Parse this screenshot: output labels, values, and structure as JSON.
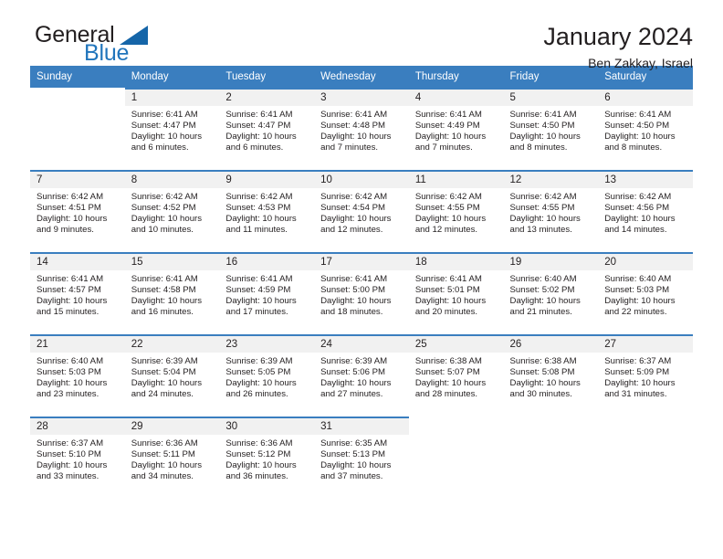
{
  "brand": {
    "name_part1": "General",
    "name_part2": "Blue",
    "accent_color": "#2175bc",
    "triangle_color": "#1565a8",
    "triangle_icon": "triangle-icon"
  },
  "header": {
    "title": "January 2024",
    "subtitle": "Ben Zakkay, Israel"
  },
  "calendar": {
    "header_bg": "#3a7ebf",
    "daynum_bg": "#f1f1f1",
    "weekday_headers": [
      "Sunday",
      "Monday",
      "Tuesday",
      "Wednesday",
      "Thursday",
      "Friday",
      "Saturday"
    ],
    "weeks": [
      [
        {
          "day": "",
          "sunrise": "",
          "sunset": "",
          "daylight_line1": "",
          "daylight_line2": ""
        },
        {
          "day": "1",
          "sunrise": "Sunrise: 6:41 AM",
          "sunset": "Sunset: 4:47 PM",
          "daylight_line1": "Daylight: 10 hours",
          "daylight_line2": "and 6 minutes."
        },
        {
          "day": "2",
          "sunrise": "Sunrise: 6:41 AM",
          "sunset": "Sunset: 4:47 PM",
          "daylight_line1": "Daylight: 10 hours",
          "daylight_line2": "and 6 minutes."
        },
        {
          "day": "3",
          "sunrise": "Sunrise: 6:41 AM",
          "sunset": "Sunset: 4:48 PM",
          "daylight_line1": "Daylight: 10 hours",
          "daylight_line2": "and 7 minutes."
        },
        {
          "day": "4",
          "sunrise": "Sunrise: 6:41 AM",
          "sunset": "Sunset: 4:49 PM",
          "daylight_line1": "Daylight: 10 hours",
          "daylight_line2": "and 7 minutes."
        },
        {
          "day": "5",
          "sunrise": "Sunrise: 6:41 AM",
          "sunset": "Sunset: 4:50 PM",
          "daylight_line1": "Daylight: 10 hours",
          "daylight_line2": "and 8 minutes."
        },
        {
          "day": "6",
          "sunrise": "Sunrise: 6:41 AM",
          "sunset": "Sunset: 4:50 PM",
          "daylight_line1": "Daylight: 10 hours",
          "daylight_line2": "and 8 minutes."
        }
      ],
      [
        {
          "day": "7",
          "sunrise": "Sunrise: 6:42 AM",
          "sunset": "Sunset: 4:51 PM",
          "daylight_line1": "Daylight: 10 hours",
          "daylight_line2": "and 9 minutes."
        },
        {
          "day": "8",
          "sunrise": "Sunrise: 6:42 AM",
          "sunset": "Sunset: 4:52 PM",
          "daylight_line1": "Daylight: 10 hours",
          "daylight_line2": "and 10 minutes."
        },
        {
          "day": "9",
          "sunrise": "Sunrise: 6:42 AM",
          "sunset": "Sunset: 4:53 PM",
          "daylight_line1": "Daylight: 10 hours",
          "daylight_line2": "and 11 minutes."
        },
        {
          "day": "10",
          "sunrise": "Sunrise: 6:42 AM",
          "sunset": "Sunset: 4:54 PM",
          "daylight_line1": "Daylight: 10 hours",
          "daylight_line2": "and 12 minutes."
        },
        {
          "day": "11",
          "sunrise": "Sunrise: 6:42 AM",
          "sunset": "Sunset: 4:55 PM",
          "daylight_line1": "Daylight: 10 hours",
          "daylight_line2": "and 12 minutes."
        },
        {
          "day": "12",
          "sunrise": "Sunrise: 6:42 AM",
          "sunset": "Sunset: 4:55 PM",
          "daylight_line1": "Daylight: 10 hours",
          "daylight_line2": "and 13 minutes."
        },
        {
          "day": "13",
          "sunrise": "Sunrise: 6:42 AM",
          "sunset": "Sunset: 4:56 PM",
          "daylight_line1": "Daylight: 10 hours",
          "daylight_line2": "and 14 minutes."
        }
      ],
      [
        {
          "day": "14",
          "sunrise": "Sunrise: 6:41 AM",
          "sunset": "Sunset: 4:57 PM",
          "daylight_line1": "Daylight: 10 hours",
          "daylight_line2": "and 15 minutes."
        },
        {
          "day": "15",
          "sunrise": "Sunrise: 6:41 AM",
          "sunset": "Sunset: 4:58 PM",
          "daylight_line1": "Daylight: 10 hours",
          "daylight_line2": "and 16 minutes."
        },
        {
          "day": "16",
          "sunrise": "Sunrise: 6:41 AM",
          "sunset": "Sunset: 4:59 PM",
          "daylight_line1": "Daylight: 10 hours",
          "daylight_line2": "and 17 minutes."
        },
        {
          "day": "17",
          "sunrise": "Sunrise: 6:41 AM",
          "sunset": "Sunset: 5:00 PM",
          "daylight_line1": "Daylight: 10 hours",
          "daylight_line2": "and 18 minutes."
        },
        {
          "day": "18",
          "sunrise": "Sunrise: 6:41 AM",
          "sunset": "Sunset: 5:01 PM",
          "daylight_line1": "Daylight: 10 hours",
          "daylight_line2": "and 20 minutes."
        },
        {
          "day": "19",
          "sunrise": "Sunrise: 6:40 AM",
          "sunset": "Sunset: 5:02 PM",
          "daylight_line1": "Daylight: 10 hours",
          "daylight_line2": "and 21 minutes."
        },
        {
          "day": "20",
          "sunrise": "Sunrise: 6:40 AM",
          "sunset": "Sunset: 5:03 PM",
          "daylight_line1": "Daylight: 10 hours",
          "daylight_line2": "and 22 minutes."
        }
      ],
      [
        {
          "day": "21",
          "sunrise": "Sunrise: 6:40 AM",
          "sunset": "Sunset: 5:03 PM",
          "daylight_line1": "Daylight: 10 hours",
          "daylight_line2": "and 23 minutes."
        },
        {
          "day": "22",
          "sunrise": "Sunrise: 6:39 AM",
          "sunset": "Sunset: 5:04 PM",
          "daylight_line1": "Daylight: 10 hours",
          "daylight_line2": "and 24 minutes."
        },
        {
          "day": "23",
          "sunrise": "Sunrise: 6:39 AM",
          "sunset": "Sunset: 5:05 PM",
          "daylight_line1": "Daylight: 10 hours",
          "daylight_line2": "and 26 minutes."
        },
        {
          "day": "24",
          "sunrise": "Sunrise: 6:39 AM",
          "sunset": "Sunset: 5:06 PM",
          "daylight_line1": "Daylight: 10 hours",
          "daylight_line2": "and 27 minutes."
        },
        {
          "day": "25",
          "sunrise": "Sunrise: 6:38 AM",
          "sunset": "Sunset: 5:07 PM",
          "daylight_line1": "Daylight: 10 hours",
          "daylight_line2": "and 28 minutes."
        },
        {
          "day": "26",
          "sunrise": "Sunrise: 6:38 AM",
          "sunset": "Sunset: 5:08 PM",
          "daylight_line1": "Daylight: 10 hours",
          "daylight_line2": "and 30 minutes."
        },
        {
          "day": "27",
          "sunrise": "Sunrise: 6:37 AM",
          "sunset": "Sunset: 5:09 PM",
          "daylight_line1": "Daylight: 10 hours",
          "daylight_line2": "and 31 minutes."
        }
      ],
      [
        {
          "day": "28",
          "sunrise": "Sunrise: 6:37 AM",
          "sunset": "Sunset: 5:10 PM",
          "daylight_line1": "Daylight: 10 hours",
          "daylight_line2": "and 33 minutes."
        },
        {
          "day": "29",
          "sunrise": "Sunrise: 6:36 AM",
          "sunset": "Sunset: 5:11 PM",
          "daylight_line1": "Daylight: 10 hours",
          "daylight_line2": "and 34 minutes."
        },
        {
          "day": "30",
          "sunrise": "Sunrise: 6:36 AM",
          "sunset": "Sunset: 5:12 PM",
          "daylight_line1": "Daylight: 10 hours",
          "daylight_line2": "and 36 minutes."
        },
        {
          "day": "31",
          "sunrise": "Sunrise: 6:35 AM",
          "sunset": "Sunset: 5:13 PM",
          "daylight_line1": "Daylight: 10 hours",
          "daylight_line2": "and 37 minutes."
        },
        {
          "day": "",
          "sunrise": "",
          "sunset": "",
          "daylight_line1": "",
          "daylight_line2": ""
        },
        {
          "day": "",
          "sunrise": "",
          "sunset": "",
          "daylight_line1": "",
          "daylight_line2": ""
        },
        {
          "day": "",
          "sunrise": "",
          "sunset": "",
          "daylight_line1": "",
          "daylight_line2": ""
        }
      ]
    ]
  }
}
